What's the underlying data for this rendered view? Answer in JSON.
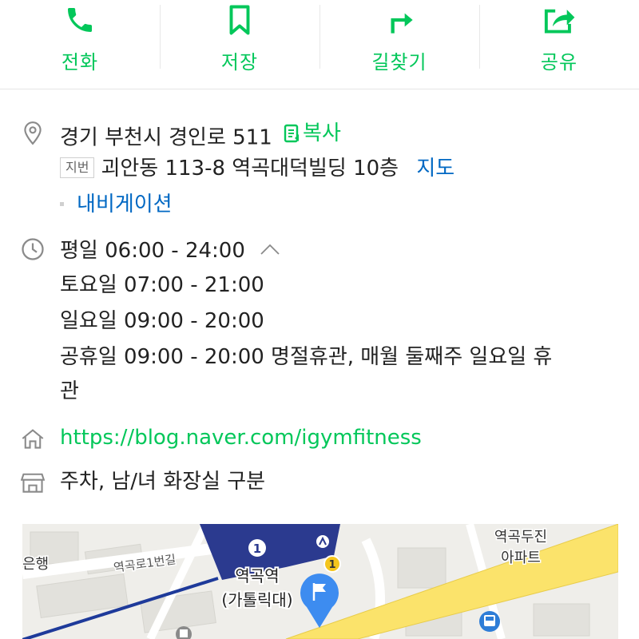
{
  "actions": [
    {
      "label": "전화",
      "icon": "phone-icon"
    },
    {
      "label": "저장",
      "icon": "bookmark-icon"
    },
    {
      "label": "길찾기",
      "icon": "directions-icon"
    },
    {
      "label": "공유",
      "icon": "share-icon"
    }
  ],
  "address": {
    "road": "경기 부천시 경인로 511",
    "copy_label": "복사",
    "jibun_tag": "지번",
    "jibun": "괴안동 113-8 역곡대덕빌딩 10층",
    "map_link": "지도",
    "navigation_link": "내비게이션"
  },
  "hours": {
    "weekday": "평일 06:00 - 24:00",
    "saturday": "토요일 07:00 - 21:00",
    "sunday": "일요일 09:00 - 20:00",
    "holiday_line1": "공휴일 09:00 - 20:00 명절휴관, 매월 둘째주 일요일 휴",
    "holiday_line2": "관"
  },
  "homepage": "https://blog.naver.com/igymfitness",
  "facilities": "주차, 남/녀 화장실 구분",
  "map": {
    "station_number": "1",
    "station_name": "역곡역",
    "station_sub": "(가톨릭대)",
    "road_label": "역곡로1번길",
    "bank_label": "은행",
    "apartment_line1": "역곡두진",
    "apartment_line2": "아파트",
    "exit_badge": "1",
    "colors": {
      "station_box": "#2b3a8f",
      "road_yellow": "#fbe36b",
      "pin_blue": "#3d8cf0",
      "line_blue": "#1e3a9a"
    }
  },
  "colors": {
    "accent_green": "#03c75a",
    "link_blue": "#0068c3",
    "icon_gray": "#8a8a8a"
  }
}
